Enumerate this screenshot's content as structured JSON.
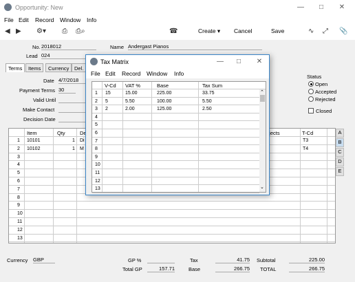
{
  "window": {
    "title": "Opportunity: New"
  },
  "menu": [
    "File",
    "Edit",
    "Record",
    "Window",
    "Info"
  ],
  "toolbar": {
    "create": "Create",
    "cancel": "Cancel",
    "save": "Save"
  },
  "header": {
    "no_label": "No.",
    "no_value": "2018012",
    "name_label": "Name",
    "name_value": "Andergast Pianos",
    "lead_label": "Lead",
    "lead_value": "024"
  },
  "tabs": [
    "Terms",
    "Items",
    "Currency",
    "Del."
  ],
  "terms": {
    "date_label": "Date",
    "date_value": "4/7/2018",
    "payment_label": "Payment Terms",
    "payment_value": "30",
    "valid_label": "Valid Until",
    "contact_label": "Make Contact",
    "decision_label": "Decision Date"
  },
  "status": {
    "label": "Status",
    "open": "Open",
    "accepted": "Accepted",
    "rejected": "Rejected",
    "closed": "Closed"
  },
  "items_grid": {
    "headers": {
      "item": "Item",
      "qty": "Qty",
      "desc": "De",
      "objects": "bjects",
      "tcd": "T-Cd"
    },
    "rows": [
      {
        "n": "1",
        "item": "10101",
        "qty": "1",
        "desc": "Di",
        "tcd": "T3"
      },
      {
        "n": "2",
        "item": "10102",
        "qty": "1",
        "desc": "M",
        "tcd": "T4"
      },
      {
        "n": "3"
      },
      {
        "n": "4"
      },
      {
        "n": "5"
      },
      {
        "n": "6"
      },
      {
        "n": "7"
      },
      {
        "n": "8"
      },
      {
        "n": "9"
      },
      {
        "n": "10"
      },
      {
        "n": "11"
      },
      {
        "n": "12"
      },
      {
        "n": "13"
      }
    ]
  },
  "side_tabs": [
    "A",
    "B",
    "C",
    "D",
    "E"
  ],
  "footer": {
    "currency_label": "Currency",
    "currency_value": "GBP",
    "gp_pct_label": "GP %",
    "tax_label": "Tax",
    "tax_value": "41.75",
    "subtotal_label": "Subtotal",
    "subtotal_value": "225.00",
    "total_gp_label": "Total GP",
    "total_gp_value": "157.71",
    "base_label": "Base",
    "base_value": "266.75",
    "total_label": "TOTAL",
    "total_value": "266.75"
  },
  "dialog": {
    "title": "Tax Matrix",
    "menu": [
      "File",
      "Edit",
      "Record",
      "Window",
      "Info"
    ],
    "headers": {
      "vcd": "V-Cd",
      "vat": "VAT %",
      "base": "Base",
      "taxsum": "Tax Sum"
    },
    "rows": [
      {
        "n": "1",
        "vcd": "15",
        "vat": "15.00",
        "base": "225.00",
        "taxsum": "33.75"
      },
      {
        "n": "2",
        "vcd": "5",
        "vat": "5.50",
        "base": "100.00",
        "taxsum": "5.50"
      },
      {
        "n": "3",
        "vcd": "2",
        "vat": "2.00",
        "base": "125.00",
        "taxsum": "2.50"
      },
      {
        "n": "4"
      },
      {
        "n": "5"
      },
      {
        "n": "6"
      },
      {
        "n": "7"
      },
      {
        "n": "8"
      },
      {
        "n": "9"
      },
      {
        "n": "10"
      },
      {
        "n": "11"
      },
      {
        "n": "12"
      },
      {
        "n": "13"
      }
    ]
  }
}
